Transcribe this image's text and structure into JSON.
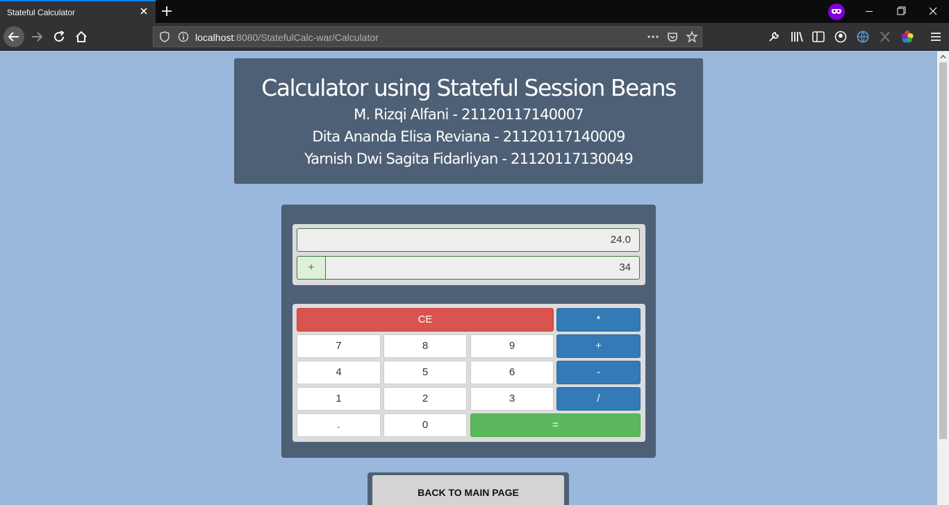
{
  "browser": {
    "tab_title": "Stateful Calculator",
    "url_host": "localhost",
    "url_rest": ":8080/StatefulCalc-war/Calculator"
  },
  "header": {
    "title": "Calculator using Stateful Session Beans",
    "authors": [
      "M. Rizqi Alfani - 21120117140007",
      "Dita Ananda Elisa Reviana - 21120117140009",
      "Yarnish Dwi Sagita Fidarliyan - 21120117130049"
    ]
  },
  "calculator": {
    "result": "24.0",
    "operator": "+",
    "input": "34",
    "keys": {
      "ce": "CE",
      "mul": "*",
      "seven": "7",
      "eight": "8",
      "nine": "9",
      "add": "+",
      "four": "4",
      "five": "5",
      "six": "6",
      "sub": "-",
      "one": "1",
      "two": "2",
      "three": "3",
      "div": "/",
      "dot": ".",
      "zero": "0",
      "equals": "="
    }
  },
  "back_button": "BACK TO MAIN PAGE",
  "colors": {
    "page_bg": "#99b8dc",
    "panel_bg": "#4e6076",
    "danger": "#d9534f",
    "primary": "#337ab7",
    "success": "#5cb85c"
  }
}
